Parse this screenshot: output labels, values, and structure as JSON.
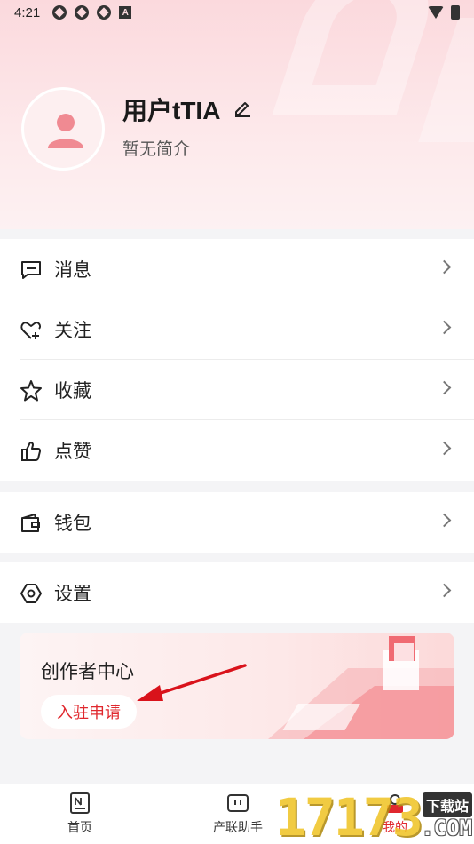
{
  "status_bar": {
    "time": "4:21",
    "app_icon_letter": "A"
  },
  "profile": {
    "username": "用户tTIA",
    "bio": "暂无简介"
  },
  "menu_group_1": [
    {
      "label": "消息",
      "icon": "message-icon"
    },
    {
      "label": "关注",
      "icon": "heart-plus-icon"
    },
    {
      "label": "收藏",
      "icon": "star-icon"
    },
    {
      "label": "点赞",
      "icon": "thumbs-up-icon"
    }
  ],
  "menu_group_2": [
    {
      "label": "钱包",
      "icon": "wallet-icon"
    }
  ],
  "menu_group_3": [
    {
      "label": "设置",
      "icon": "settings-icon"
    }
  ],
  "creator_center": {
    "title": "创作者中心",
    "apply_label": "入驻申请"
  },
  "tab_bar": {
    "tabs": [
      {
        "label": "首页",
        "icon": "news-icon"
      },
      {
        "label": "产联助手",
        "icon": "assistant-icon"
      },
      {
        "label": "我的",
        "icon": "profile-icon"
      }
    ],
    "active_index": 2
  },
  "watermark": {
    "digits": "17173",
    "badge": "下载站",
    "suffix": ".COM"
  },
  "colors": {
    "accent": "#e0282e",
    "header_bg": "#fbd9dd",
    "page_bg": "#f4f4f6"
  }
}
